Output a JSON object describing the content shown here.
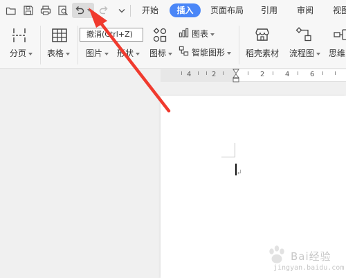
{
  "quick_access": {
    "open": "folder-icon",
    "save": "save-icon",
    "print": "printer-icon",
    "preview": "print-preview-icon",
    "undo": "undo-icon",
    "redo": "redo-icon",
    "more": "chevron-down-icon"
  },
  "tabs": [
    {
      "label": "开始",
      "active": false
    },
    {
      "label": "插入",
      "active": true
    },
    {
      "label": "页面布局",
      "active": false
    },
    {
      "label": "引用",
      "active": false
    },
    {
      "label": "审阅",
      "active": false
    },
    {
      "label": "视图",
      "active": false
    }
  ],
  "ribbon": {
    "page_break": "分页",
    "table": "表格",
    "picture": "图片",
    "shape": "形状",
    "icon": "图标",
    "chart": "图表",
    "smart_art": "智能图形",
    "docer": "稻壳素材",
    "flowchart": "流程图",
    "mindmap": "思维"
  },
  "tooltip": "撤消(Ctrl+Z)",
  "ruler": {
    "numbers": [
      "4",
      "2",
      "2",
      "4",
      "6"
    ]
  },
  "watermark": {
    "text": "Bai经验",
    "sub": "jingyan.baidu.com"
  },
  "colors": {
    "accent": "#4a86f7",
    "arrow": "#f03a2e"
  }
}
